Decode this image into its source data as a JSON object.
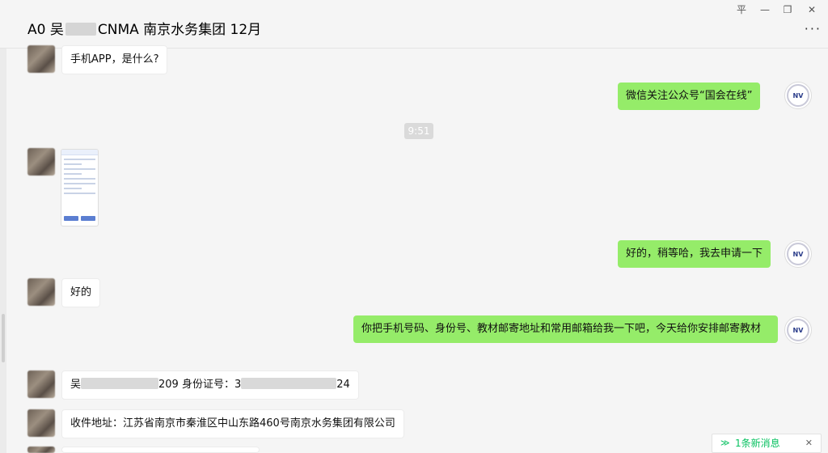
{
  "header": {
    "title_prefix": "A0 吴",
    "title_suffix": "CNMA 南京水务集团 12月",
    "pin_icon": "pin-icon",
    "minimize_glyph": "—",
    "maximize_glyph": "❐",
    "close_glyph": "✕",
    "pin_glyph": "平",
    "more_glyph": "···"
  },
  "timestamp": "9:51",
  "messages": {
    "m1": "手机APP，是什么?",
    "m2": "微信关注公众号“国会在线”",
    "m4": "好的，稍等哈，我去申请一下",
    "m5": "好的",
    "m6": "你把手机号码、身份号、教材邮寄地址和常用邮箱给我一下吧，今天给你安排邮寄教材",
    "m7_prefix": "吴",
    "m7_mid": "209 身份证号：3",
    "m7_suffix": "24",
    "m8": "收件地址：江苏省南京市秦淮区中山东路460号南京水务集团有限公司"
  },
  "self_avatar_text": "NV",
  "new_message_bar": {
    "chevron": "≫",
    "label": "1条新消息",
    "close": "✕"
  }
}
